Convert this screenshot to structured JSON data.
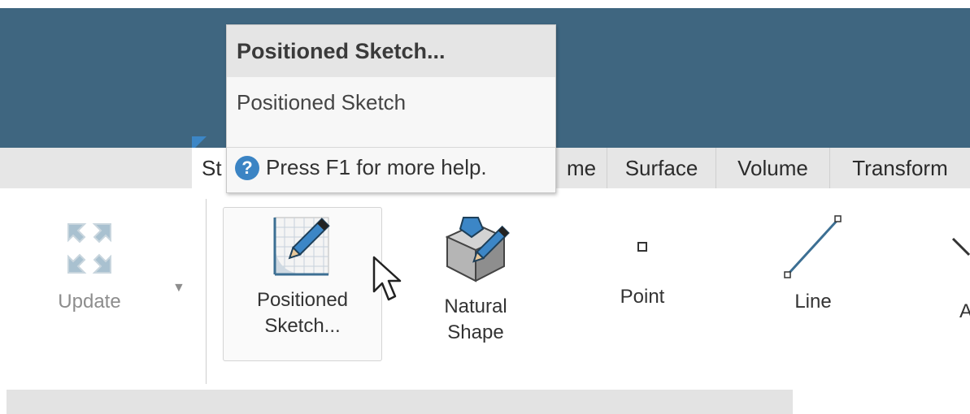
{
  "tooltip": {
    "title": "Positioned Sketch...",
    "description": "Positioned Sketch",
    "help": "Press F1 for more help."
  },
  "tabs": [
    {
      "label": "St"
    },
    {
      "label": "me"
    },
    {
      "label": "Surface"
    },
    {
      "label": "Volume"
    },
    {
      "label": "Transform"
    }
  ],
  "ribbon": {
    "update": {
      "label": "Update",
      "dropdown_glyph": "▼",
      "icon": "update-arrows-icon"
    },
    "sketch": {
      "line1": "Positioned",
      "line2": "Sketch...",
      "icon": "positioned-sketch-icon"
    },
    "natural": {
      "line1": "Natural",
      "line2": "Shape",
      "icon": "natural-shape-icon"
    },
    "point": {
      "label": "Point",
      "icon": "point-icon"
    },
    "line": {
      "label": "Line",
      "icon": "line-icon"
    },
    "partial": {
      "label": "A"
    }
  },
  "colors": {
    "header": "#3f6680",
    "accent": "#3b84c4",
    "ribbon_bg": "#ffffff",
    "tab_bg": "#e6e6e6"
  }
}
